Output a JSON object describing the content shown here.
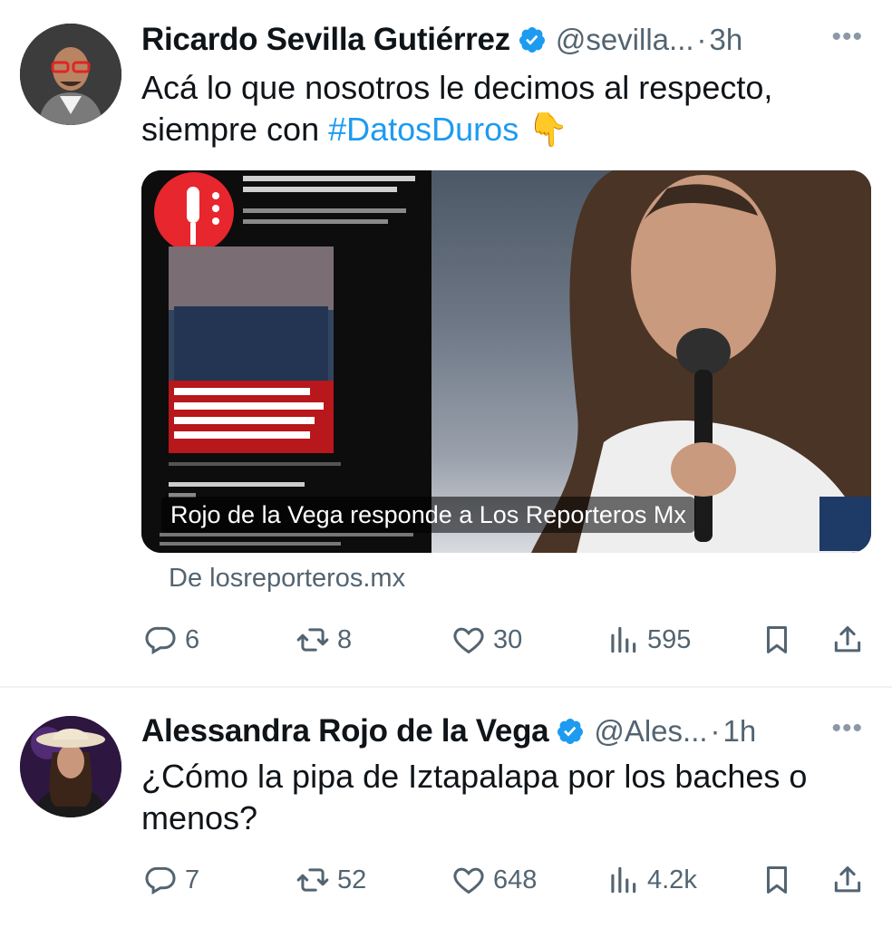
{
  "tweets": [
    {
      "name": "Ricardo Sevilla Gutiérrez",
      "handle": "@sevilla...",
      "separator": "·",
      "time": "3h",
      "more": "•••",
      "text_line1": "Acá lo que nosotros le decimos al respecto,",
      "text_line2_prefix": "siempre con ",
      "hashtag": "#DatosDuros",
      "emoji": "👇",
      "card_title": "Rojo de la Vega responde a Los Reporteros Mx",
      "card_source": "De losreporteros.mx",
      "replies": "6",
      "retweets": "8",
      "likes": "30",
      "views": "595"
    },
    {
      "name": "Alessandra Rojo de la Vega",
      "handle": "@Ales...",
      "separator": "·",
      "time": "1h",
      "more": "•••",
      "text_line1": "¿Cómo la pipa de Iztapalapa por los baches o",
      "text_line2": "menos?",
      "replies": "7",
      "retweets": "52",
      "likes": "648",
      "views": "4.2k"
    }
  ],
  "colors": {
    "accent": "#1d9bf0",
    "secondary_text": "#536471",
    "primary_text": "#0f1419"
  }
}
